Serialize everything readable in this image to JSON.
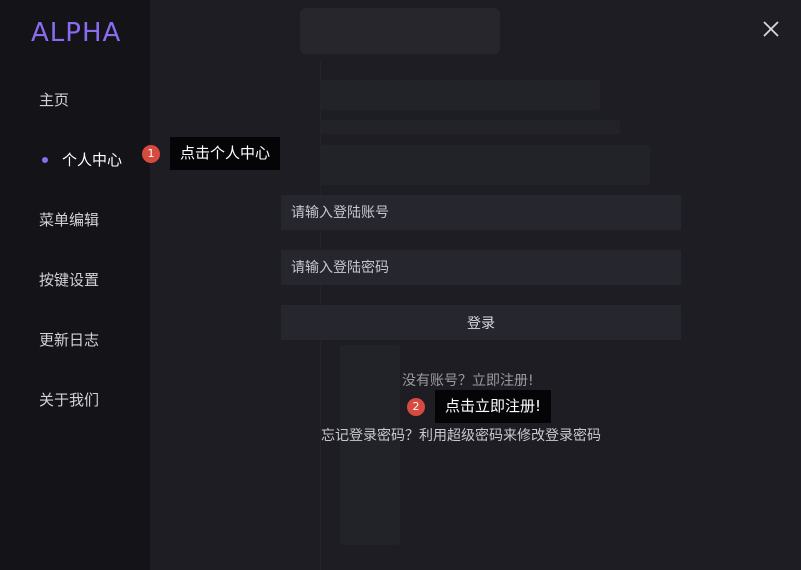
{
  "app": {
    "logo": "ALPHA"
  },
  "sidebar": {
    "items": [
      {
        "label": "主页",
        "active": false
      },
      {
        "label": "个人中心",
        "active": true
      },
      {
        "label": "菜单编辑",
        "active": false
      },
      {
        "label": "按键设置",
        "active": false
      },
      {
        "label": "更新日志",
        "active": false
      },
      {
        "label": "关于我们",
        "active": false
      }
    ]
  },
  "tooltips": [
    {
      "num": "1",
      "text": "点击个人中心"
    },
    {
      "num": "2",
      "text": "点击立即注册!"
    }
  ],
  "login": {
    "account_placeholder": "请输入登陆账号",
    "password_placeholder": "请输入登陆密码",
    "submit_label": "登录",
    "register_text": "没有账号？立即注册!",
    "forgot_text": "忘记登录密码？利用超级密码来修改登录密码"
  },
  "colors": {
    "accent": "#8a6cf0",
    "badge": "#d64a3f"
  }
}
